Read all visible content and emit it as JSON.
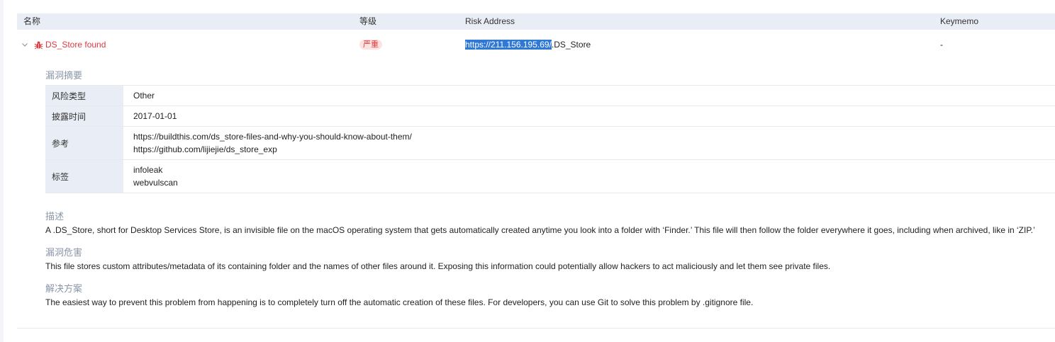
{
  "table": {
    "headers": {
      "name": "名称",
      "level": "等级",
      "risk_address": "Risk Address",
      "keymemo": "Keymemo"
    },
    "row": {
      "name": "DS_Store found",
      "severity": "严重",
      "address_selected": "https://211.156.195.69/",
      "address_rest": ".DS_Store",
      "keymemo": "-"
    }
  },
  "details": {
    "summary_title": "漏洞摘要",
    "rows": [
      {
        "key": "风险类型",
        "values": [
          "Other"
        ]
      },
      {
        "key": "披露时间",
        "values": [
          "2017-01-01"
        ]
      },
      {
        "key": "参考",
        "values": [
          "https://buildthis.com/ds_store-files-and-why-you-should-know-about-them/",
          "https://github.com/lijiejie/ds_store_exp"
        ]
      },
      {
        "key": "标签",
        "values": [
          "infoleak",
          "webvulscan"
        ]
      }
    ],
    "description_title": "描述",
    "description": "A .DS_Store, short for Desktop Services Store, is an invisible file on the macOS operating system that gets automatically created anytime you look into a folder with ‘Finder.’ This file will then follow the folder everywhere it goes, including when archived, like in ‘ZIP.’",
    "harm_title": "漏洞危害",
    "harm": "This file stores custom attributes/metadata of its containing folder and the names of other files around it. Exposing this information could potentially allow hackers to act maliciously and let them see private files.",
    "solution_title": "解决方案",
    "solution": "The easiest way to prevent this problem from happening is to completely turn off the automatic creation of these files. For developers, you can use Git to solve this problem by .gitignore file."
  },
  "colors": {
    "danger": "#e0393e",
    "header_bg": "#e9eef6",
    "selection": "#2f78d6",
    "muted_title": "#8a96a8"
  },
  "icons": {
    "expand": "chevron-down-icon",
    "vuln": "bug-icon"
  }
}
